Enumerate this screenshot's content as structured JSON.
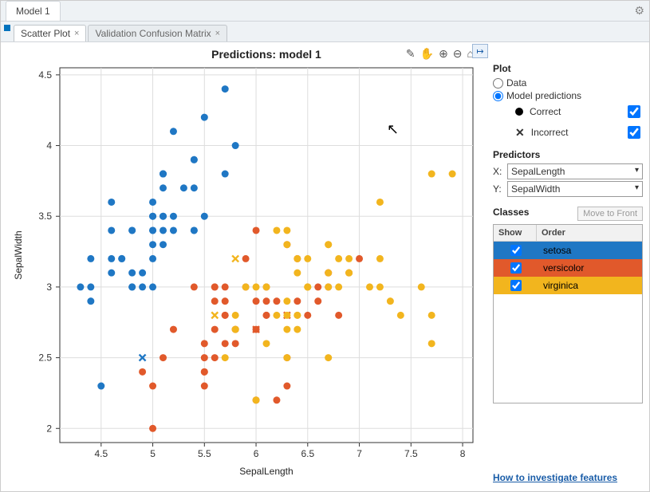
{
  "window": {
    "title": "Model 1"
  },
  "tabs": [
    {
      "label": "Scatter Plot",
      "active": true
    },
    {
      "label": "Validation Confusion Matrix",
      "active": false
    }
  ],
  "side": {
    "plot_heading": "Plot",
    "radio_data": "Data",
    "radio_modelpred": "Model predictions",
    "legend_correct": "Correct",
    "legend_incorrect": "Incorrect",
    "predictors_heading": "Predictors",
    "x_label": "X:",
    "y_label": "Y:",
    "x_value": "SepalLength",
    "y_value": "SepalWidth",
    "classes_heading": "Classes",
    "move_front": "Move to Front",
    "col_show": "Show",
    "col_order": "Order",
    "classes": [
      {
        "name": "setosa",
        "color": "#1f77c4"
      },
      {
        "name": "versicolor",
        "color": "#e1592b"
      },
      {
        "name": "virginica",
        "color": "#f2b51e"
      }
    ],
    "footer_link": "How to investigate features"
  },
  "chart_data": {
    "type": "scatter",
    "title": "Predictions: model 1",
    "xlabel": "SepalLength",
    "ylabel": "SepalWidth",
    "xlim": [
      4.1,
      8.1
    ],
    "ylim": [
      1.9,
      4.55
    ],
    "xticks": [
      4.5,
      5,
      5.5,
      6,
      6.5,
      7,
      7.5,
      8
    ],
    "yticks": [
      2,
      2.5,
      3,
      3.5,
      4,
      4.5
    ],
    "series": [
      {
        "name": "setosa",
        "color": "#1f77c4",
        "correct": [
          [
            5.1,
            3.5
          ],
          [
            4.9,
            3.0
          ],
          [
            4.7,
            3.2
          ],
          [
            4.6,
            3.1
          ],
          [
            5.0,
            3.6
          ],
          [
            5.4,
            3.9
          ],
          [
            4.6,
            3.4
          ],
          [
            5.0,
            3.4
          ],
          [
            4.4,
            2.9
          ],
          [
            4.9,
            3.1
          ],
          [
            5.4,
            3.7
          ],
          [
            4.8,
            3.4
          ],
          [
            4.8,
            3.0
          ],
          [
            4.3,
            3.0
          ],
          [
            5.8,
            4.0
          ],
          [
            5.7,
            4.4
          ],
          [
            5.4,
            3.9
          ],
          [
            5.1,
            3.5
          ],
          [
            5.7,
            3.8
          ],
          [
            5.1,
            3.8
          ],
          [
            5.4,
            3.4
          ],
          [
            5.1,
            3.7
          ],
          [
            4.6,
            3.6
          ],
          [
            5.1,
            3.3
          ],
          [
            4.8,
            3.4
          ],
          [
            5.0,
            3.0
          ],
          [
            5.0,
            3.4
          ],
          [
            5.2,
            3.5
          ],
          [
            5.2,
            3.4
          ],
          [
            4.7,
            3.2
          ],
          [
            4.8,
            3.1
          ],
          [
            5.4,
            3.4
          ],
          [
            5.2,
            4.1
          ],
          [
            5.5,
            4.2
          ],
          [
            5.0,
            3.2
          ],
          [
            5.5,
            3.5
          ],
          [
            4.4,
            3.0
          ],
          [
            5.1,
            3.4
          ],
          [
            5.0,
            3.5
          ],
          [
            4.5,
            2.3
          ],
          [
            4.4,
            3.2
          ],
          [
            5.0,
            3.5
          ],
          [
            5.1,
            3.8
          ],
          [
            4.8,
            3.0
          ],
          [
            5.1,
            3.8
          ],
          [
            4.6,
            3.2
          ],
          [
            5.3,
            3.7
          ],
          [
            5.0,
            3.3
          ]
        ],
        "incorrect": [
          [
            4.9,
            2.5
          ]
        ]
      },
      {
        "name": "versicolor",
        "color": "#e1592b",
        "correct": [
          [
            7.0,
            3.2
          ],
          [
            6.4,
            3.2
          ],
          [
            6.9,
            3.1
          ],
          [
            5.5,
            2.3
          ],
          [
            6.5,
            2.8
          ],
          [
            5.7,
            2.8
          ],
          [
            6.3,
            3.3
          ],
          [
            4.9,
            2.4
          ],
          [
            6.6,
            2.9
          ],
          [
            5.2,
            2.7
          ],
          [
            5.0,
            2.0
          ],
          [
            5.9,
            3.0
          ],
          [
            6.0,
            2.2
          ],
          [
            6.1,
            2.9
          ],
          [
            5.6,
            2.9
          ],
          [
            6.7,
            3.1
          ],
          [
            5.6,
            3.0
          ],
          [
            5.8,
            2.7
          ],
          [
            6.2,
            2.2
          ],
          [
            5.6,
            2.5
          ],
          [
            5.9,
            3.2
          ],
          [
            6.1,
            2.8
          ],
          [
            6.3,
            2.5
          ],
          [
            6.1,
            2.8
          ],
          [
            6.4,
            2.9
          ],
          [
            6.6,
            3.0
          ],
          [
            6.8,
            2.8
          ],
          [
            6.7,
            3.0
          ],
          [
            6.0,
            2.9
          ],
          [
            5.7,
            2.6
          ],
          [
            5.5,
            2.4
          ],
          [
            5.5,
            2.4
          ],
          [
            5.8,
            2.7
          ],
          [
            6.0,
            2.7
          ],
          [
            5.4,
            3.0
          ],
          [
            6.0,
            3.4
          ],
          [
            6.7,
            3.1
          ],
          [
            6.3,
            2.3
          ],
          [
            5.6,
            3.0
          ],
          [
            5.5,
            2.5
          ],
          [
            5.5,
            2.6
          ],
          [
            6.1,
            3.0
          ],
          [
            5.8,
            2.6
          ],
          [
            5.0,
            2.3
          ],
          [
            5.6,
            2.7
          ],
          [
            5.7,
            3.0
          ],
          [
            5.7,
            2.9
          ],
          [
            6.2,
            2.9
          ],
          [
            5.1,
            2.5
          ],
          [
            5.7,
            2.8
          ]
        ],
        "incorrect": [
          [
            6.0,
            2.7
          ],
          [
            6.3,
            2.8
          ]
        ]
      },
      {
        "name": "virginica",
        "color": "#f2b51e",
        "correct": [
          [
            6.3,
            3.3
          ],
          [
            5.8,
            2.7
          ],
          [
            7.1,
            3.0
          ],
          [
            6.3,
            2.9
          ],
          [
            6.5,
            3.0
          ],
          [
            7.6,
            3.0
          ],
          [
            7.3,
            2.9
          ],
          [
            6.7,
            2.5
          ],
          [
            7.2,
            3.6
          ],
          [
            6.5,
            3.2
          ],
          [
            6.4,
            2.7
          ],
          [
            6.8,
            3.0
          ],
          [
            5.7,
            2.5
          ],
          [
            5.8,
            2.8
          ],
          [
            6.4,
            3.2
          ],
          [
            6.5,
            3.0
          ],
          [
            7.7,
            3.8
          ],
          [
            7.7,
            2.6
          ],
          [
            6.0,
            2.2
          ],
          [
            6.9,
            3.2
          ],
          [
            7.7,
            2.8
          ],
          [
            6.3,
            2.7
          ],
          [
            6.7,
            3.3
          ],
          [
            7.2,
            3.2
          ],
          [
            6.2,
            2.8
          ],
          [
            6.1,
            3.0
          ],
          [
            6.4,
            2.8
          ],
          [
            7.2,
            3.0
          ],
          [
            7.4,
            2.8
          ],
          [
            7.9,
            3.8
          ],
          [
            6.4,
            2.8
          ],
          [
            6.3,
            2.8
          ],
          [
            6.1,
            2.6
          ],
          [
            6.3,
            3.4
          ],
          [
            6.4,
            3.1
          ],
          [
            6.0,
            3.0
          ],
          [
            6.9,
            3.1
          ],
          [
            6.7,
            3.1
          ],
          [
            6.9,
            3.1
          ],
          [
            5.8,
            2.7
          ],
          [
            6.8,
            3.2
          ],
          [
            6.7,
            3.3
          ],
          [
            6.7,
            3.0
          ],
          [
            6.3,
            2.5
          ],
          [
            6.5,
            3.0
          ],
          [
            6.2,
            3.4
          ],
          [
            5.9,
            3.0
          ]
        ],
        "incorrect": [
          [
            5.6,
            2.8
          ],
          [
            5.8,
            3.2
          ]
        ]
      }
    ]
  }
}
